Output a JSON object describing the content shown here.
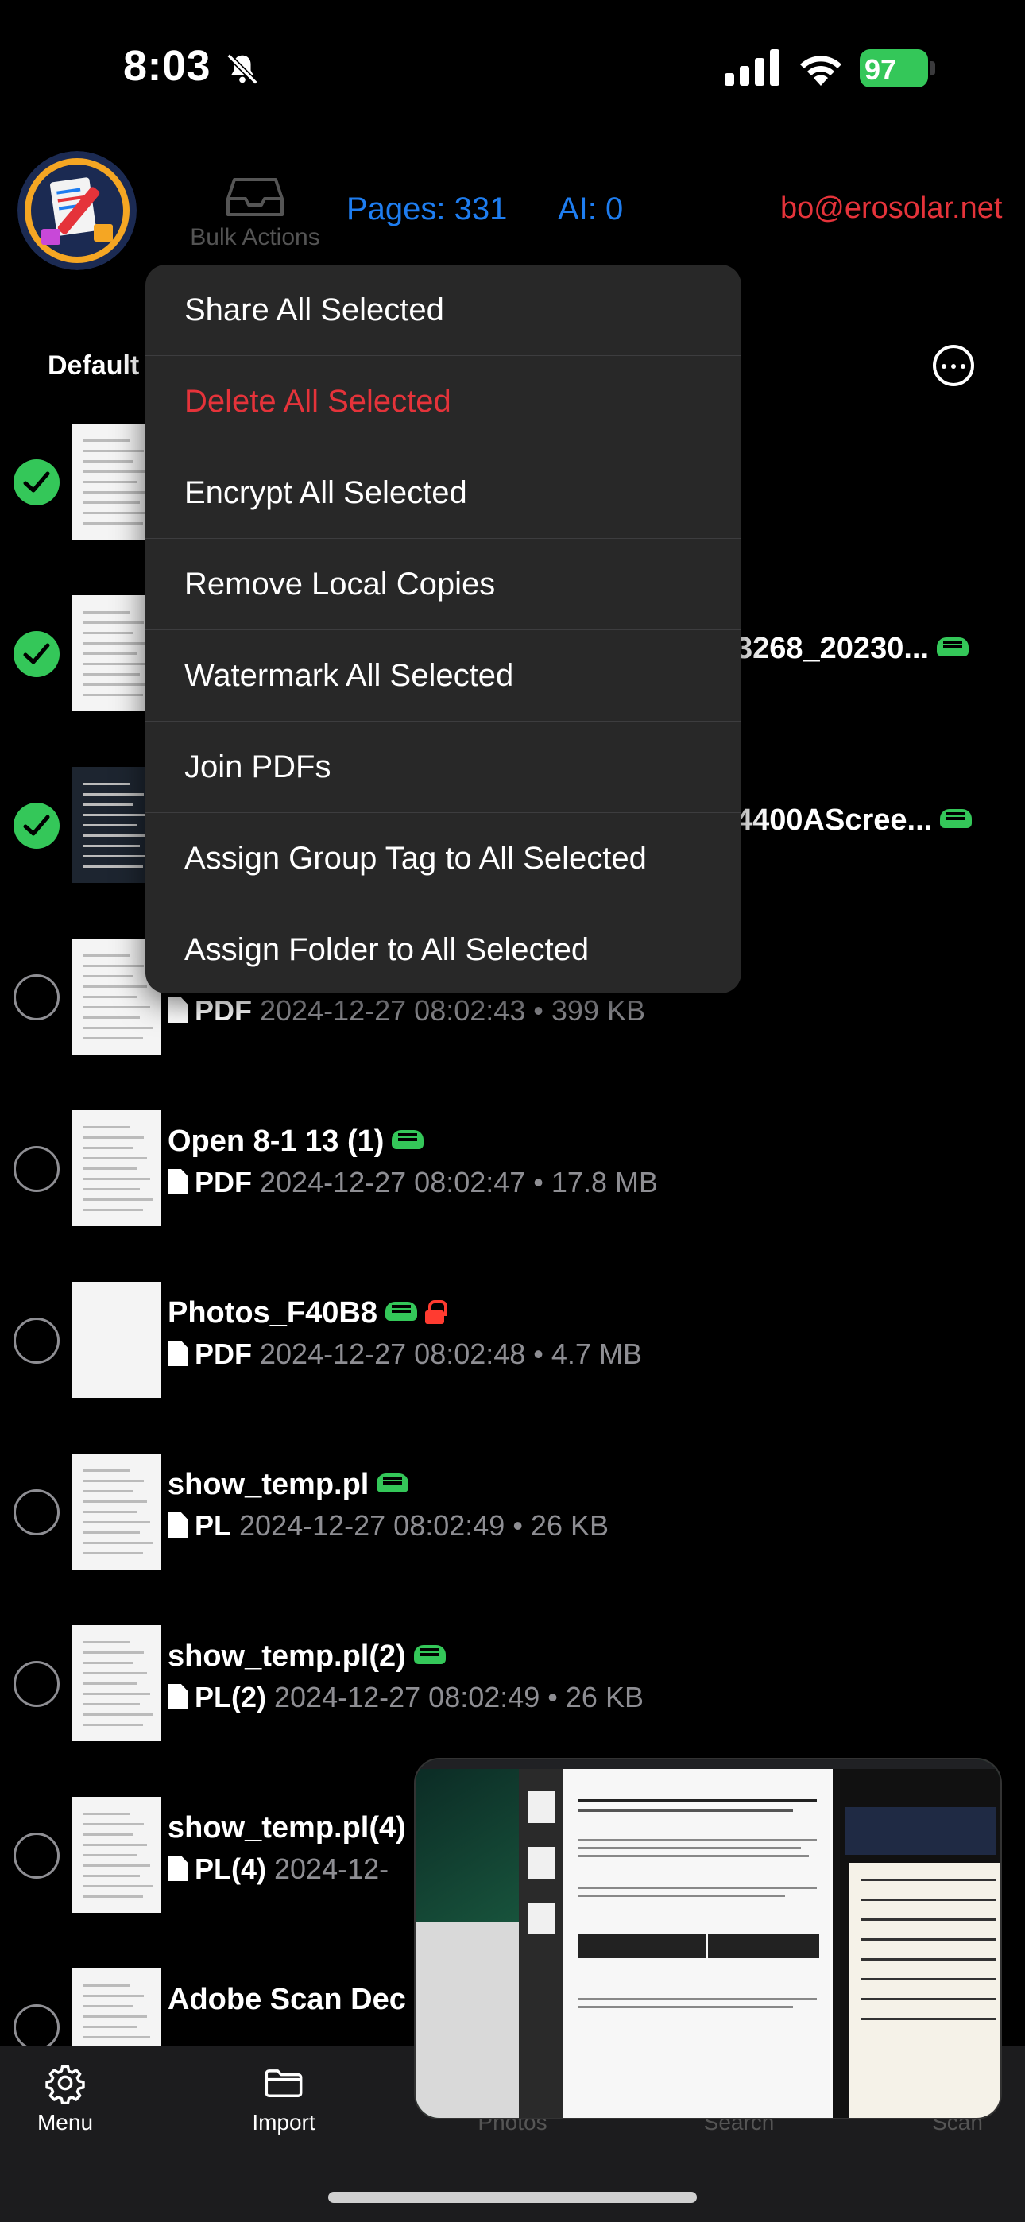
{
  "status_bar": {
    "time": "8:03",
    "battery": "97"
  },
  "header": {
    "bulk_actions_label": "Bulk Actions",
    "pages_label": "Pages: 331",
    "ai_label": "AI: 0",
    "user_email": "bo@erosolar.net"
  },
  "section": {
    "title": "Default"
  },
  "menu": {
    "items": [
      {
        "label": "Share All Selected"
      },
      {
        "label": "Delete All Selected"
      },
      {
        "label": "Encrypt All Selected"
      },
      {
        "label": "Remove Local Copies"
      },
      {
        "label": "Watermark All Selected"
      },
      {
        "label": "Join PDFs"
      },
      {
        "label": "Assign Group Tag to All Selected"
      },
      {
        "label": "Assign Folder to All Selected"
      }
    ]
  },
  "documents": [
    {
      "name": "",
      "type": "",
      "meta": "",
      "selected": true
    },
    {
      "name": "3268_20230...",
      "type": "",
      "meta": "",
      "selected": true
    },
    {
      "name": "4400AScree...",
      "type": "",
      "meta": "",
      "selected": true
    },
    {
      "name": "",
      "type": "PDF",
      "meta": "2024-12-27 08:02:43 • 399 KB",
      "selected": false
    },
    {
      "name": "Open 8-1 13 (1)",
      "type": "PDF",
      "meta": "2024-12-27 08:02:47 • 17.8 MB",
      "selected": false
    },
    {
      "name": "Photos_F40B8",
      "type": "PDF",
      "meta": "2024-12-27 08:02:48 • 4.7 MB",
      "selected": false
    },
    {
      "name": "show_temp.pl",
      "type": "PL",
      "meta": "2024-12-27 08:02:49 • 26 KB",
      "selected": false
    },
    {
      "name": "show_temp.pl(2)",
      "type": "PL(2)",
      "meta": "2024-12-27 08:02:49 • 26 KB",
      "selected": false
    },
    {
      "name": "show_temp.pl(4)",
      "type": "PL(4)",
      "meta": "2024-12-",
      "selected": false
    },
    {
      "name": "Adobe Scan Dec",
      "type": "",
      "meta": "",
      "selected": false
    }
  ],
  "tabbar": {
    "menu": "Menu",
    "import": "Import",
    "photos": "Photos",
    "search": "Search",
    "scan": "Scan"
  },
  "colors": {
    "accent_blue": "#1e7df0",
    "destructive_red": "#e5333a",
    "success_green": "#34c759",
    "menu_bg": "#282828"
  }
}
